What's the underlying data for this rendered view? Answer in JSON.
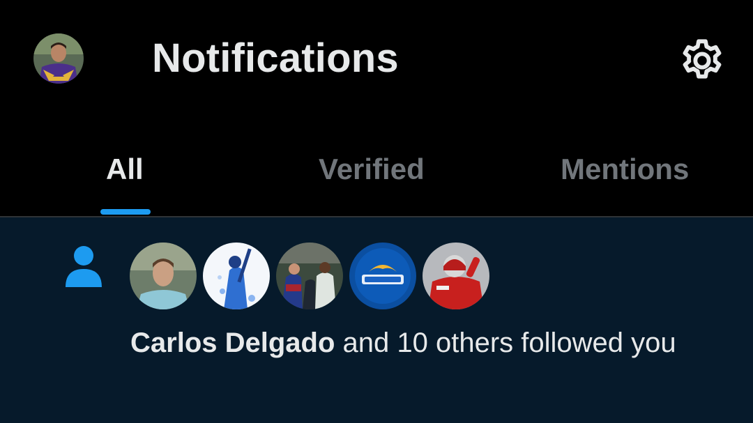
{
  "header": {
    "title": "Notifications",
    "avatar_icon": "user-avatar",
    "settings_icon": "gear-icon"
  },
  "tabs": [
    {
      "label": "All",
      "active": true
    },
    {
      "label": "Verified",
      "active": false
    },
    {
      "label": "Mentions",
      "active": false
    }
  ],
  "notification": {
    "type_icon": "person-icon",
    "follower_avatars": [
      "follower-avatar-1",
      "follower-avatar-2",
      "follower-avatar-3",
      "follower-avatar-4",
      "follower-avatar-5"
    ],
    "actor_name": "Carlos Delgado",
    "message_rest": " and 10 others followed you"
  },
  "colors": {
    "background": "#000000",
    "notification_background": "#061a2b",
    "accent": "#1d9bf0",
    "text_primary": "#e7e9ea",
    "text_secondary": "#71767b"
  }
}
